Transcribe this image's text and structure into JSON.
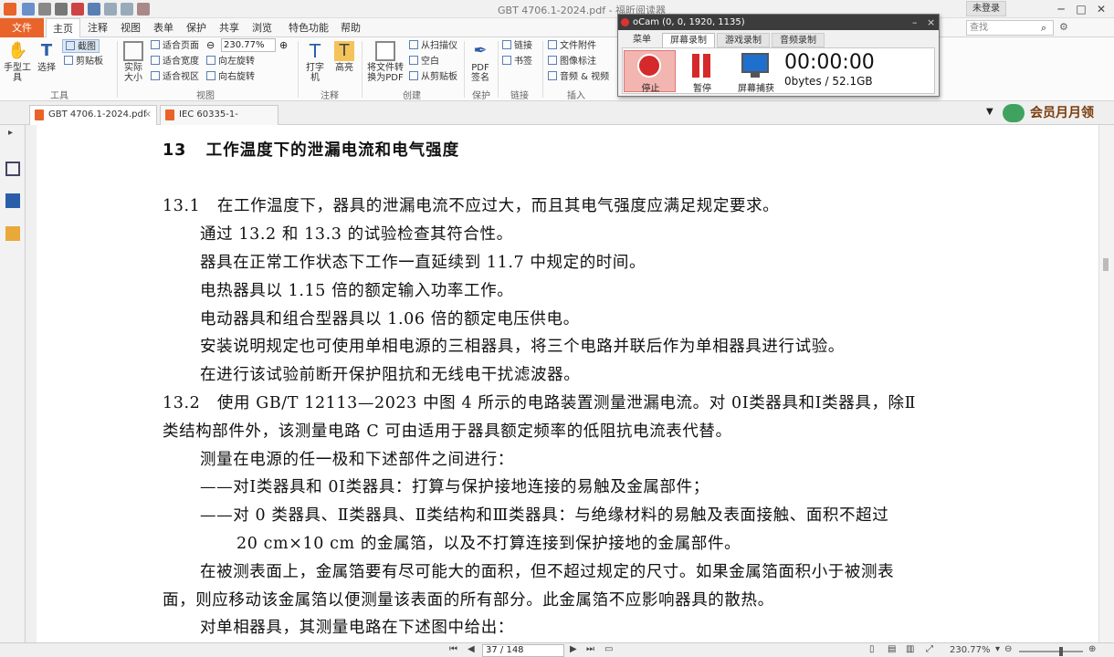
{
  "titlebar": {
    "doc_title": "GBT 4706.1-2024.pdf - 福昕阅读器",
    "login": "未登录",
    "minimize": "─",
    "restore": "□",
    "close": "✕"
  },
  "menu": {
    "file": "文件",
    "tabs": [
      "主页",
      "注释",
      "视图",
      "表单",
      "保护",
      "共享",
      "浏览",
      "特色功能",
      "帮助"
    ],
    "active": "主页",
    "search_placeholder": "查找"
  },
  "ribbon": {
    "hand_tool": "手型工具",
    "select": "选择",
    "screenshot": "截图",
    "clipboard": "剪贴板",
    "group_tools": "工具",
    "actual_size": "实际大小",
    "fit_page": "适合页面",
    "fit_width": "适合宽度",
    "fit_view": "适合视区",
    "zoom_value": "230.77%",
    "rotate_left": "向左旋转",
    "rotate_right": "向右旋转",
    "group_view": "视图",
    "typewriter": "打字机",
    "highlight": "高亮",
    "group_comment": "注释",
    "convert": "将文件转换为PDF",
    "from_scanner": "从扫描仪",
    "blank": "空白",
    "from_clipboard": "从剪贴板",
    "group_create": "创建",
    "pdf_sign": "PDF签名",
    "group_protect": "保护",
    "link": "链接",
    "bookmark": "书签",
    "group_link": "链接",
    "attachment": "文件附件",
    "image_annot": "图像标注",
    "audio_video": "音频 & 视频",
    "group_insert": "插入"
  },
  "doctabs": [
    {
      "label": "GBT 4706.1-2024.pdf",
      "active": true
    },
    {
      "label": "IEC 60335-1-2020.pdf",
      "active": false
    }
  ],
  "vip": "会员月月领",
  "document": {
    "heading_num": "13",
    "heading": "工作温度下的泄漏电流和电气强度",
    "lines": [
      {
        "num": "13.1",
        "text": "在工作温度下，器具的泄漏电流不应过大，而且其电气强度应满足规定要求。"
      },
      {
        "text": "通过 13.2 和 13.3 的试验检查其符合性。"
      },
      {
        "text": "器具在正常工作状态下工作一直延续到 11.7 中规定的时间。"
      },
      {
        "text": "电热器具以 1.15 倍的额定输入功率工作。"
      },
      {
        "text": "电动器具和组合型器具以 1.06 倍的额定电压供电。"
      },
      {
        "text": "安装说明规定也可使用单相电源的三相器具，将三个电路并联后作为单相器具进行试验。"
      },
      {
        "text": "在进行该试验前断开保护阻抗和无线电干扰滤波器。"
      },
      {
        "num": "13.2",
        "text": "使用 GB/T 12113—2023 中图 4 所示的电路装置测量泄漏电流。对 0Ⅰ类器具和Ⅰ类器具，除Ⅱ"
      },
      {
        "text": "类结构部件外，该测量电路 C 可由适用于器具额定频率的低阻抗电流表代替。"
      },
      {
        "text": "测量在电源的任一极和下述部件之间进行："
      },
      {
        "text": "——对Ⅰ类器具和 0Ⅰ类器具：打算与保护接地连接的易触及金属部件；"
      },
      {
        "text": "——对 0 类器具、Ⅱ类器具、Ⅱ类结构和Ⅲ类器具：与绝缘材料的易触及表面接触、面积不超过"
      },
      {
        "text": "20 cm×10 cm 的金属箔，以及不打算连接到保护接地的金属部件。"
      },
      {
        "text": "在被测表面上，金属箔要有尽可能大的面积，但不超过规定的尺寸。如果金属箔面积小于被测表"
      },
      {
        "text": "面，则应移动该金属箔以便测量该表面的所有部分。此金属箔不应影响器具的散热。"
      },
      {
        "text": "对单相器具，其测量电路在下述图中给出："
      }
    ]
  },
  "statusbar": {
    "page": "37 / 148",
    "zoom": "230.77%"
  },
  "ocam": {
    "title": "oCam (0, 0, 1920, 1135)",
    "tabs": [
      "菜单",
      "屏幕录制",
      "游戏录制",
      "音频录制"
    ],
    "active_tab": "屏幕录制",
    "stop": "停止",
    "pause": "暂停",
    "capture": "屏幕捕获",
    "timer": "00:00:00",
    "size": "0bytes / 52.1GB"
  },
  "colors": {
    "accent": "#e8642a",
    "record_red": "#d5292b"
  }
}
